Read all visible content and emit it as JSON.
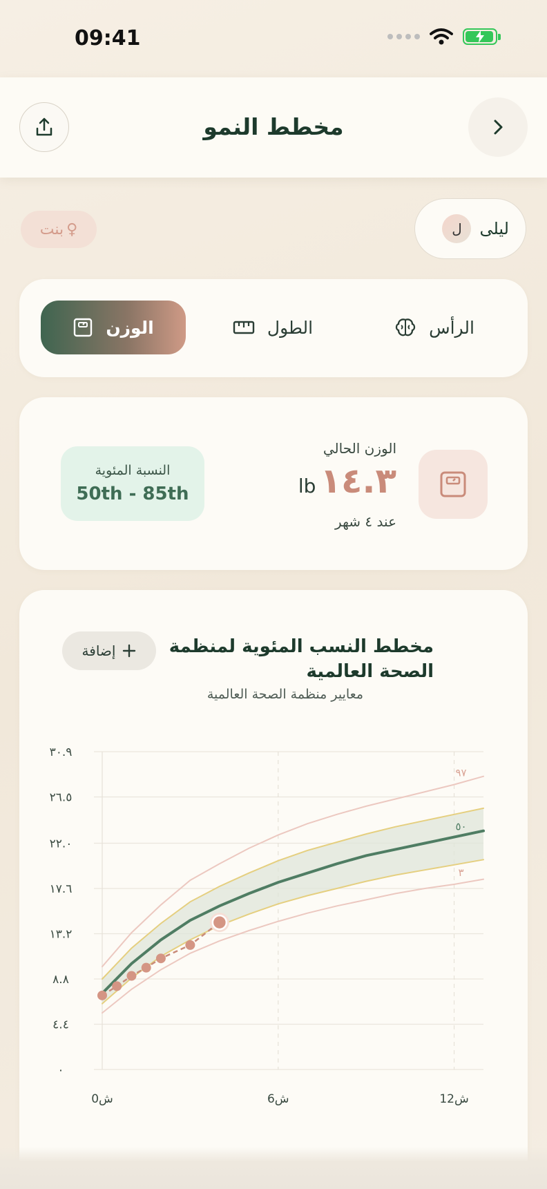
{
  "status_bar": {
    "time": "09:41"
  },
  "header": {
    "title": "مخطط النمو"
  },
  "child": {
    "name": "ليلى",
    "initial": "ل",
    "gender": "بنت"
  },
  "tabs": [
    {
      "label": "الوزن",
      "icon": "scale-icon",
      "active": true
    },
    {
      "label": "الطول",
      "icon": "ruler-icon",
      "active": false
    },
    {
      "label": "الرأس",
      "icon": "brain-icon",
      "active": false
    }
  ],
  "current": {
    "label": "الوزن الحالي",
    "value": "١٤.٣",
    "unit": "lb",
    "age_text": "عند ٤ شهر",
    "percentile_label": "النسبة المئوية",
    "percentile_value": "50th - 85th"
  },
  "chart_section": {
    "title": "مخطط النسب المئوية لمنظمة الصحة العالمية",
    "subtitle": "معايير منظمة الصحة العالمية",
    "add_label": "إضافة"
  },
  "colors": {
    "accent_green": "#4f7d63",
    "accent_rose": "#d49584",
    "band_yellow": "#e5cf7f",
    "band_fill": "#dfe6da"
  },
  "chart_data": {
    "type": "line",
    "y_ticks": [
      "٠",
      "٤.٤",
      "٨.٨",
      "١٣.٢",
      "١٧.٦",
      "٢٢.٠",
      "٢٦.٥",
      "٣٠.٩"
    ],
    "y_tick_values": [
      0,
      4.4,
      8.8,
      13.2,
      17.6,
      22.0,
      26.5,
      30.9
    ],
    "x_ticks": [
      "0ش",
      "6ش",
      "12ش"
    ],
    "x_tick_values": [
      0,
      6,
      12
    ],
    "xlim": [
      0,
      13
    ],
    "ylim": [
      0,
      30.9
    ],
    "curve_labels": {
      "p97": "٩٧",
      "p50": "٥٠",
      "p3": "٣"
    },
    "x": [
      0,
      1,
      2,
      3,
      4,
      5,
      6,
      7,
      8,
      9,
      10,
      11,
      12,
      13
    ],
    "series": [
      {
        "key": "p97",
        "values": [
          10.0,
          13.3,
          16.0,
          18.4,
          20.0,
          21.5,
          22.8,
          23.9,
          24.8,
          25.6,
          26.3,
          27.0,
          27.7,
          28.5
        ]
      },
      {
        "key": "p85",
        "values": [
          8.8,
          11.8,
          14.2,
          16.3,
          17.8,
          19.1,
          20.3,
          21.3,
          22.1,
          22.9,
          23.6,
          24.2,
          24.8,
          25.4
        ]
      },
      {
        "key": "p50",
        "values": [
          7.4,
          10.3,
          12.6,
          14.5,
          15.9,
          17.1,
          18.2,
          19.1,
          20.0,
          20.8,
          21.4,
          22.0,
          22.6,
          23.2
        ]
      },
      {
        "key": "p15",
        "values": [
          6.4,
          8.9,
          11.0,
          12.6,
          14.0,
          15.1,
          16.1,
          16.9,
          17.6,
          18.3,
          18.9,
          19.4,
          19.9,
          20.4
        ]
      },
      {
        "key": "p3",
        "values": [
          5.5,
          7.8,
          9.7,
          11.3,
          12.5,
          13.5,
          14.4,
          15.2,
          15.9,
          16.5,
          17.1,
          17.6,
          18.0,
          18.5
        ]
      }
    ],
    "measurements": {
      "x": [
        0,
        0.5,
        1,
        1.5,
        2,
        3,
        4
      ],
      "y": [
        7.2,
        8.1,
        9.1,
        9.9,
        10.8,
        12.1,
        14.3
      ]
    }
  }
}
